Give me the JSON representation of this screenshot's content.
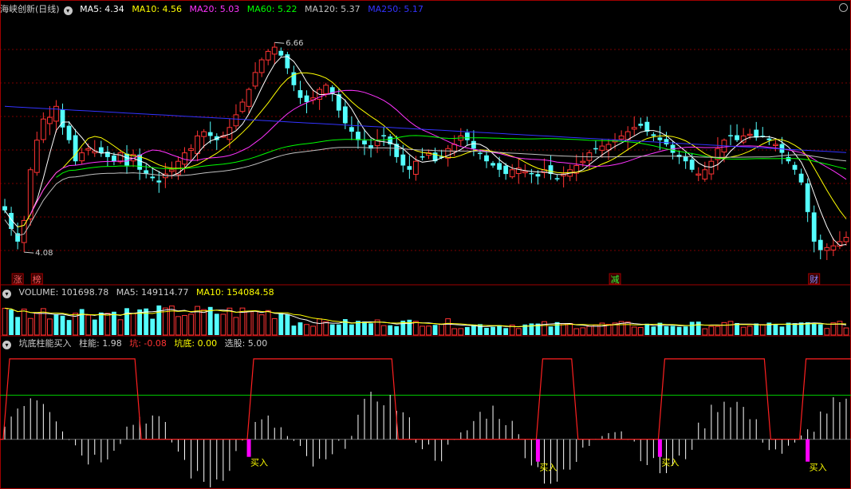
{
  "colors": {
    "bg": "#000000",
    "up": "#ff3333",
    "down": "#54ffff",
    "grid": "#7a0000",
    "ma5": "#ffffff",
    "ma10": "#ffff00",
    "ma20": "#ff33ff",
    "ma60": "#00ff00",
    "ma120": "#c0c0c0",
    "ma250": "#3333ff",
    "marker": "#ff00ff",
    "text": "#cccccc"
  },
  "price_panel": {
    "title": "海峡创新(日线)",
    "legend": [
      {
        "label": "MA5: 4.34",
        "color": "#ffffff"
      },
      {
        "label": "MA10: 4.56",
        "color": "#ffff00"
      },
      {
        "label": "MA20: 5.03",
        "color": "#ff33ff"
      },
      {
        "label": "MA60: 5.22",
        "color": "#00ff00"
      },
      {
        "label": "MA120: 5.37",
        "color": "#c0c0c0"
      },
      {
        "label": "MA250: 5.17",
        "color": "#3333ff"
      }
    ],
    "high_label": "6.66",
    "low_label": "4.08",
    "tags": [
      {
        "text": "涨",
        "x_index": 2
      },
      {
        "text": "榜",
        "x_index": 5
      },
      {
        "text": "减",
        "x_index": 95
      },
      {
        "text": "财",
        "x_index": 126
      }
    ]
  },
  "volume_panel": {
    "legend": [
      {
        "label": "VOLUME: 101698.78",
        "color": "#cccccc"
      },
      {
        "label": "MA5: 149114.77",
        "color": "#cccccc"
      },
      {
        "label": "MA10: 154084.58",
        "color": "#ffff00"
      }
    ]
  },
  "indicator_panel": {
    "legend": [
      {
        "label": "坑底柱能买入",
        "color": "#cccccc"
      },
      {
        "label": "柱能: 1.98",
        "color": "#cccccc"
      },
      {
        "label": "坑: -0.08",
        "color": "#ff3333"
      },
      {
        "label": "坑底: 0.00",
        "color": "#ffff00"
      },
      {
        "label": "选股: 5.00",
        "color": "#cccccc"
      }
    ],
    "buy_label": "买入"
  },
  "chart_data": {
    "type": "candlestick",
    "bars": 132,
    "price_ylim": [
      3.9,
      6.9
    ],
    "close": [
      4.62,
      4.4,
      4.25,
      4.5,
      5.1,
      5.45,
      5.7,
      5.72,
      5.85,
      5.6,
      5.45,
      5.2,
      5.3,
      5.35,
      5.32,
      5.3,
      5.25,
      5.2,
      5.3,
      5.15,
      5.28,
      5.1,
      5.05,
      5.0,
      4.95,
      5.05,
      5.1,
      5.2,
      5.3,
      5.35,
      5.5,
      5.55,
      5.5,
      5.45,
      5.5,
      5.6,
      5.75,
      5.9,
      6.05,
      6.25,
      6.4,
      6.5,
      6.55,
      6.45,
      6.3,
      6.1,
      5.95,
      5.9,
      5.95,
      6.05,
      6.1,
      6.0,
      5.8,
      5.65,
      5.55,
      5.45,
      5.4,
      5.35,
      5.45,
      5.5,
      5.4,
      5.25,
      5.15,
      5.1,
      5.2,
      5.25,
      5.3,
      5.2,
      5.25,
      5.35,
      5.4,
      5.5,
      5.45,
      5.35,
      5.3,
      5.2,
      5.15,
      5.1,
      5.05,
      5.1,
      5.12,
      5.08,
      5.05,
      5.02,
      5.1,
      5.05,
      5.0,
      5.05,
      5.1,
      5.15,
      5.2,
      5.3,
      5.35,
      5.38,
      5.4,
      5.45,
      5.5,
      5.55,
      5.6,
      5.62,
      5.55,
      5.5,
      5.45,
      5.4,
      5.3,
      5.25,
      5.2,
      5.1,
      5.05,
      5.1,
      5.2,
      5.35,
      5.45,
      5.5,
      5.45,
      5.5,
      5.52,
      5.48,
      5.5,
      5.45,
      5.4,
      5.3,
      5.2,
      5.1,
      4.95,
      4.6,
      4.25,
      4.15,
      4.18,
      4.2,
      4.25,
      4.3
    ],
    "volume_ylim": [
      0,
      280000
    ],
    "volume_up": [
      true,
      false,
      false,
      true,
      true,
      true,
      true,
      true,
      false,
      false,
      false,
      true,
      false,
      true,
      false,
      false,
      true,
      false,
      true,
      false,
      true,
      false,
      false,
      false,
      false,
      true,
      true,
      true,
      true,
      true,
      true,
      true,
      false,
      false,
      true,
      true,
      true,
      true,
      true,
      true,
      true,
      true,
      true,
      false,
      false,
      false,
      false,
      true,
      true,
      true,
      true,
      false,
      false,
      false,
      false,
      false,
      false,
      false,
      true,
      true,
      false,
      false,
      false,
      false,
      true,
      true,
      true,
      false,
      true,
      true,
      true,
      true,
      false,
      false,
      false,
      false,
      false,
      false,
      false,
      true,
      true,
      false,
      false,
      false,
      true,
      false,
      false,
      true,
      true,
      true,
      true,
      true,
      true,
      true,
      true,
      true,
      true,
      true,
      true,
      true,
      false,
      false,
      false,
      false,
      false,
      false,
      false,
      false,
      false,
      true,
      true,
      true,
      true,
      true,
      false,
      true,
      true,
      false,
      true,
      false,
      false,
      false,
      false,
      false,
      false,
      false,
      false,
      false,
      true,
      true,
      true,
      true
    ],
    "indicator_ylim": [
      -1.5,
      2.8
    ],
    "pit_segments": [
      [
        0,
        21
      ],
      [
        38,
        61
      ],
      [
        83,
        89
      ],
      [
        102,
        119
      ],
      [
        124,
        137
      ]
    ],
    "buy_indices": [
      38,
      83,
      102,
      125
    ]
  }
}
